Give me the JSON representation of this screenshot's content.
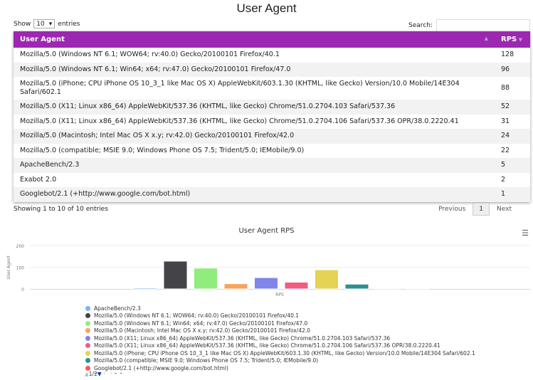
{
  "title": "User Agent",
  "length": {
    "show": "Show",
    "value": "10",
    "entries": "entries"
  },
  "search": {
    "label": "Search:",
    "value": ""
  },
  "table": {
    "headers": [
      "User Agent",
      "RPS"
    ],
    "rows": [
      [
        "Mozilla/5.0 (Windows NT 6.1; WOW64; rv:40.0) Gecko/20100101 Firefox/40.1",
        "128"
      ],
      [
        "Mozilla/5.0 (Windows NT 6.1; Win64; x64; rv:47.0) Gecko/20100101 Firefox/47.0",
        "96"
      ],
      [
        "Mozilla/5.0 (iPhone; CPU iPhone OS 10_3_1 like Mac OS X) AppleWebKit/603.1.30 (KHTML, like Gecko) Version/10.0 Mobile/14E304 Safari/602.1",
        "88"
      ],
      [
        "Mozilla/5.0 (X11; Linux x86_64) AppleWebKit/537.36 (KHTML, like Gecko) Chrome/51.0.2704.103 Safari/537.36",
        "52"
      ],
      [
        "Mozilla/5.0 (X11; Linux x86_64) AppleWebKit/537.36 (KHTML, like Gecko) Chrome/51.0.2704.106 Safari/537.36 OPR/38.0.2220.41",
        "31"
      ],
      [
        "Mozilla/5.0 (Macintosh; Intel Mac OS X x.y; rv:42.0) Gecko/20100101 Firefox/42.0",
        "24"
      ],
      [
        "Mozilla/5.0 (compatible; MSIE 9.0; Windows Phone OS 7.5; Trident/5.0; IEMobile/9.0)",
        "22"
      ],
      [
        "ApacheBench/2.3",
        "5"
      ],
      [
        "Exabot 2.0",
        "2"
      ],
      [
        "Googlebot/2.1 (+http://www.google.com/bot.html)",
        "1"
      ]
    ]
  },
  "info": "Showing 1 to 10 of 10 entries",
  "pagination": {
    "prev": "Previous",
    "page": "1",
    "next": "Next"
  },
  "chart_data": {
    "type": "bar",
    "title": "User Agent RPS",
    "xlabel": "RPS",
    "ylabel": "User Agent",
    "ylim": [
      0,
      200
    ],
    "yticks": [
      "0",
      "100",
      "200"
    ],
    "categories": [
      "RPS"
    ],
    "series": [
      {
        "name": "ApacheBench/2.3",
        "value": 5,
        "color": "#7cb5ec"
      },
      {
        "name": "Mozilla/5.0 (Windows NT 6.1; WOW64; rv:40.0) Gecko/20100101 Firefox/40.1",
        "value": 128,
        "color": "#434348"
      },
      {
        "name": "Mozilla/5.0 (Windows NT 6.1; Win64; x64; rv:47.0) Gecko/20100101 Firefox/47.0",
        "value": 96,
        "color": "#90ed7d"
      },
      {
        "name": "Mozilla/5.0 (Macintosh; Intel Mac OS X x.y; rv:42.0) Gecko/20100101 Firefox/42.0",
        "value": 24,
        "color": "#f7a35c"
      },
      {
        "name": "Mozilla/5.0 (X11; Linux x86_64) AppleWebKit/537.36 (KHTML, like Gecko) Chrome/51.0.2704.103 Safari/537.36",
        "value": 52,
        "color": "#8085e9"
      },
      {
        "name": "Mozilla/5.0 (X11; Linux x86_64) AppleWebKit/537.36 (KHTML, like Gecko) Chrome/51.0.2704.106 Safari/537.36 OPR/38.0.2220.41",
        "value": 31,
        "color": "#f15c80"
      },
      {
        "name": "Mozilla/5.0 (iPhone; CPU iPhone OS 10_3_1 like Mac OS X) AppleWebKit/603.1.30 (KHTML, like Gecko) Version/10.0 Mobile/14E304 Safari/602.1",
        "value": 88,
        "color": "#e4d354"
      },
      {
        "name": "Mozilla/5.0 (compatible; MSIE 9.0; Windows Phone OS 7.5; Trident/5.0; IEMobile/9.0)",
        "value": 22,
        "color": "#2b908f"
      },
      {
        "name": "Googlebot/2.1 (+http://www.google.com/bot.html)",
        "value": 1,
        "color": "#f45b5b"
      },
      {
        "name": "Exabot 2.0",
        "value": 2,
        "color": "#91e8e1"
      }
    ],
    "legend_page": "1/2"
  }
}
